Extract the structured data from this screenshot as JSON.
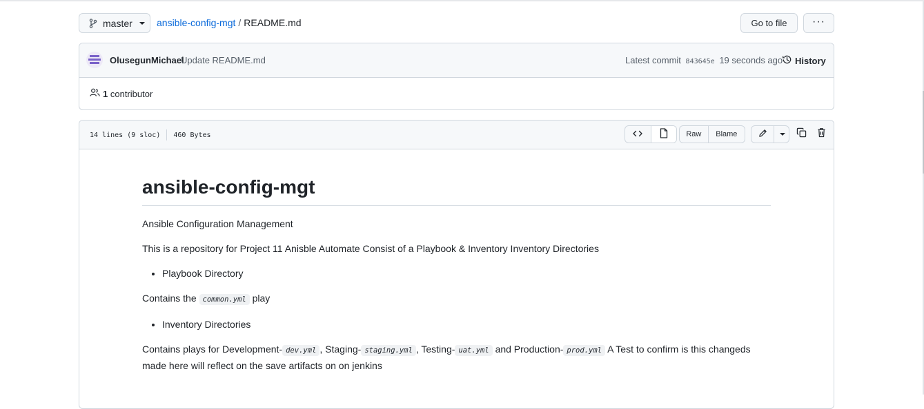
{
  "breadcrumb": {
    "branch": "master",
    "repo": "ansible-config-mgt",
    "separator": "/",
    "file": "README.md"
  },
  "actions": {
    "go_to_file": "Go to file",
    "more": "···"
  },
  "commit": {
    "author": "OlusegunMichael",
    "message": "Update README.md",
    "latest_label": "Latest commit",
    "sha": "843645e",
    "time": "19 seconds ago",
    "history_label": "History"
  },
  "contributors": {
    "count": "1",
    "label": "contributor"
  },
  "file_header": {
    "lines": "14 lines (9 sloc)",
    "size": "460 Bytes",
    "raw": "Raw",
    "blame": "Blame"
  },
  "readme": {
    "title": "ansible-config-mgt",
    "p1": "Ansible Configuration Management",
    "p2": "This is a repository for Project 11 Anisble Automate Consist of a Playbook & Inventory Inventory Directories",
    "li1": "Playbook Directory",
    "p3_pre": "Contains the",
    "p3_code": "common.yml",
    "p3_post": "play",
    "li2": "Inventory Directories",
    "p4_a": "Contains plays for Development-",
    "p4_code1": "dev.yml",
    "p4_b": ", Staging-",
    "p4_code2": "staging.yml",
    "p4_c": ", Testing-",
    "p4_code3": "uat.yml",
    "p4_d": "and Production-",
    "p4_code4": "prod.yml",
    "p4_e": "A Test to confirm is this changeds made here will reflect on the save artifacts on on jenkins"
  },
  "icons": {
    "branch": "git-branch-icon",
    "history": "history-icon",
    "people": "people-icon",
    "code": "code-icon",
    "file": "file-icon",
    "pencil": "pencil-icon",
    "copy": "copy-icon",
    "trash": "trash-icon"
  },
  "colors": {
    "link": "#0969da",
    "muted": "#57606a",
    "border": "#d0d7de",
    "header_bg": "#f6f8fa"
  }
}
